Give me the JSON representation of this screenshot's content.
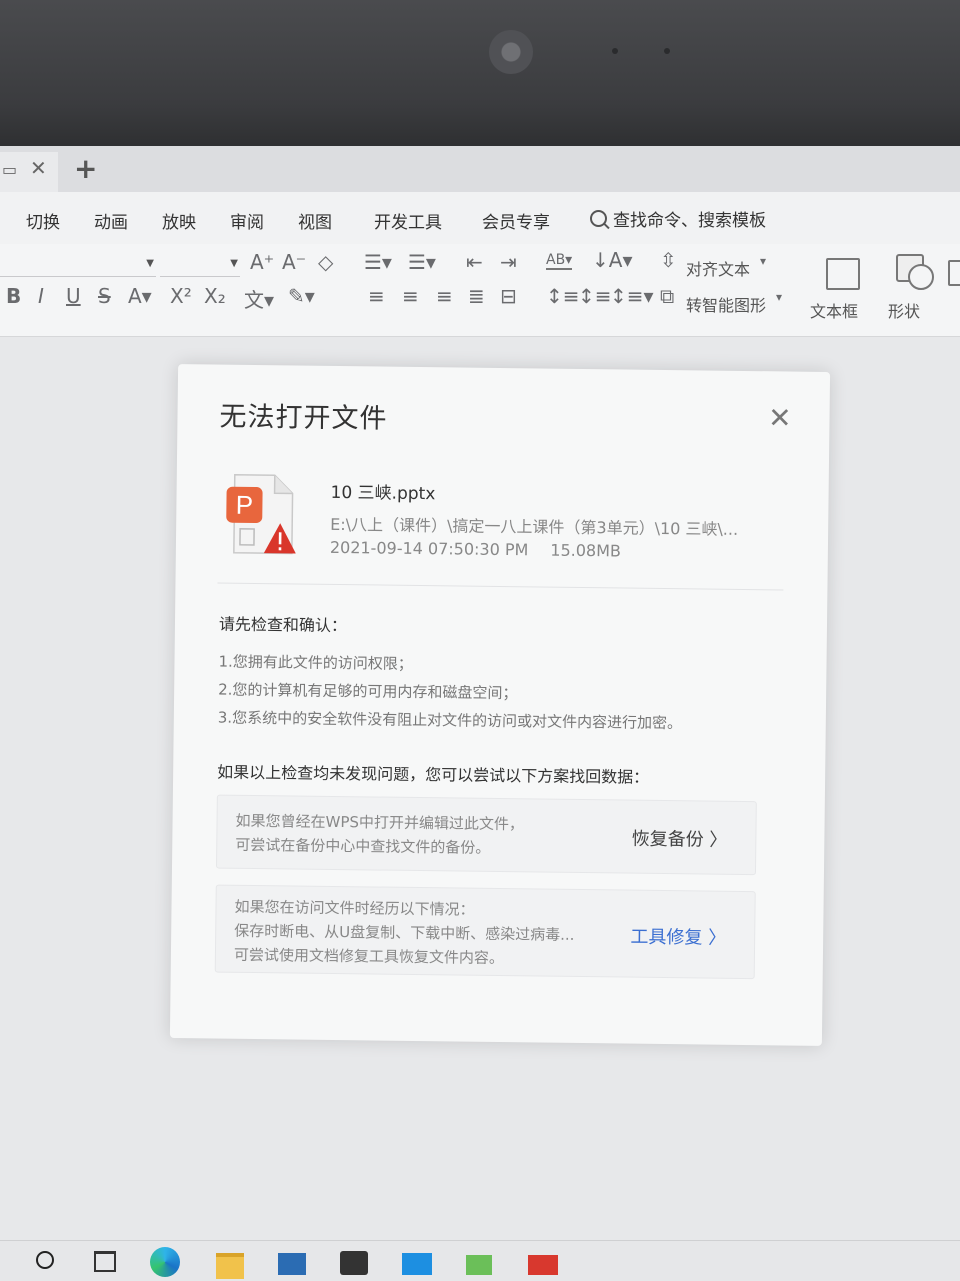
{
  "tabbar": {
    "new_tab": "+"
  },
  "menu": {
    "items": [
      "切换",
      "动画",
      "放映",
      "审阅",
      "视图",
      "开发工具",
      "会员专享"
    ],
    "search": "查找命令、搜索模板"
  },
  "toolbar": {
    "align_text": "对齐文本",
    "smart_shape": "转智能图形",
    "textbox": "文本框",
    "shape": "形状"
  },
  "dialog": {
    "title": "无法打开文件",
    "file": {
      "icon_letter": "P",
      "name": "10 三峡.pptx",
      "path": "E:\\八上（课件）\\搞定一八上课件（第3单元）\\10 三峡\\...",
      "date": "2021-09-14  07:50:30 PM",
      "size": "15.08MB"
    },
    "check_heading": "请先检查和确认：",
    "check_items": [
      "1.您拥有此文件的访问权限；",
      "2.您的计算机有足够的可用内存和磁盘空间；",
      "3.您系统中的安全软件没有阻止对文件的访问或对文件内容进行加密。"
    ],
    "alt_heading": "如果以上检查均未发现问题，您可以尝试以下方案找回数据：",
    "backup_card": {
      "line1": "如果您曾经在WPS中打开并编辑过此文件，",
      "line2": "可尝试在备份中心中查找文件的备份。",
      "action": "恢复备份 〉"
    },
    "repair_card": {
      "line1": "如果您在访问文件时经历以下情况：",
      "line2": "保存时断电、从U盘复制、下载中断、感染过病毒...",
      "line3": "可尝试使用文档修复工具恢复文件内容。",
      "action": "工具修复 〉"
    }
  },
  "colors": {
    "accent_link": "#3b6fd1",
    "wps_orange": "#e8663d",
    "warning_red": "#d9362b"
  }
}
